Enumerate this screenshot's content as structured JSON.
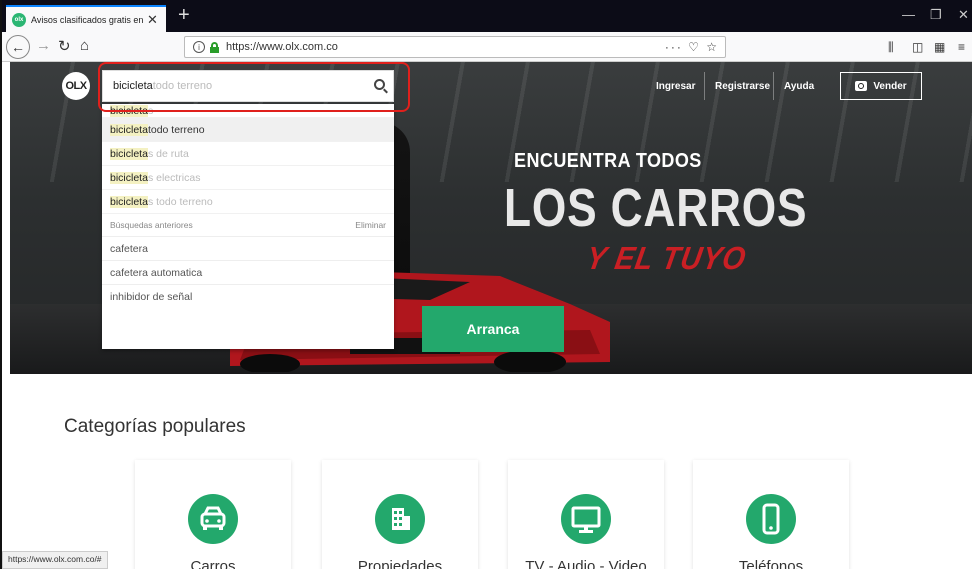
{
  "browser": {
    "tab_title": "Avisos clasificados gratis en Co",
    "url": "https://www.olx.com.co",
    "status_url": "https://www.olx.com.co/#"
  },
  "header": {
    "logo": "OLX",
    "links": [
      "Ingresar",
      "Registrarse",
      "Ayuda"
    ],
    "sell_button": "Vender"
  },
  "search": {
    "typed": "bicicleta",
    "hint": "todo terreno",
    "suggestions": [
      {
        "match": "bicicleta",
        "rest": "s"
      },
      {
        "match": "bicicleta",
        "rest": " todo terreno"
      },
      {
        "match": "bicicleta",
        "rest": "s de ruta"
      },
      {
        "match": "bicicleta",
        "rest": "s electricas"
      },
      {
        "match": "bicicleta",
        "rest": "s todo terreno"
      }
    ],
    "previous_label": "Búsquedas anteriores",
    "clear_label": "Eliminar",
    "previous": [
      "cafetera",
      "cafetera automatica",
      "inhibidor de señal"
    ]
  },
  "hero": {
    "line1": "ENCUENTRA TODOS",
    "line2": "LOS CARROS",
    "line3": "Y EL TUYO",
    "cta": "Arranca"
  },
  "categories": {
    "title": "Categorías populares",
    "items": [
      {
        "label": "Carros",
        "icon": "car-icon"
      },
      {
        "label": "Propiedades",
        "icon": "building-icon"
      },
      {
        "label": "TV - Audio - Video",
        "icon": "monitor-icon"
      },
      {
        "label": "Teléfonos",
        "icon": "phone-icon"
      }
    ]
  },
  "colors": {
    "brand_green": "#23a86c",
    "highlight_red": "#e0201c",
    "match_highlight": "#f4f1c2"
  }
}
